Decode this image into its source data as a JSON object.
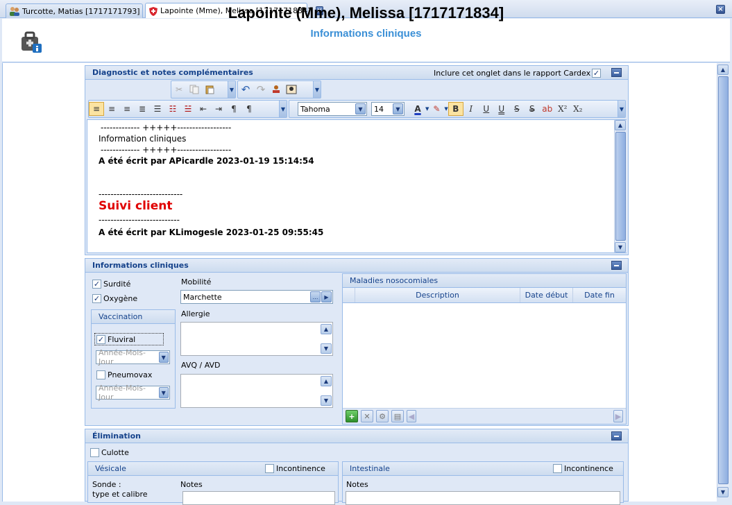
{
  "tabs": [
    {
      "label": "Turcotte, Matias [1717171793]",
      "icon": "users-icon"
    },
    {
      "label": "Lapointe (Mme), Melissa [1717171834]",
      "icon": "shield-icon"
    }
  ],
  "header": {
    "title": "Lapointe (Mme), Melissa [1717171834]",
    "subtitle": "Informations cliniques",
    "icon": "medical-bag-info-icon"
  },
  "diagnostic": {
    "title": "Diagnostic et notes complémentaires",
    "cardex_label": "Inclure cet onglet dans le rapport Cardex",
    "cardex_checked": "✓",
    "font_name": "Tahoma",
    "font_size": "14",
    "toolbar_letters": {
      "bold": "B",
      "italic": "I",
      "underline": "U",
      "underline2": "U",
      "strike": "S",
      "strike2": "S",
      "super": "X²",
      "sub": "X₂",
      "font_color": "A",
      "pilcrow": "¶"
    },
    "editor_lines": {
      "l1": "------------- +++++------------------",
      "l2": "Information cliniques",
      "l3": "------------- +++++------------------",
      "l4": "A été écrit par APicardle 2023-01-19 15:14:54",
      "l5": "----------------------------",
      "l6": "Suivi client",
      "l7": "---------------------------",
      "l8": "A été écrit par KLimogesle 2023-01-25 09:55:45"
    }
  },
  "clinical": {
    "title": "Informations cliniques",
    "surdite": "Surdité",
    "oxygene": "Oxygène",
    "check": "✓",
    "mobilite_label": "Mobilité",
    "mobilite_value": "Marchette",
    "allergie_label": "Allergie",
    "avq_label": "AVQ / AVD",
    "vaccination_title": "Vaccination",
    "fluviral": "Fluviral",
    "pneumovax": "Pneumovax",
    "date_placeholder": "Année-Mois-Jour",
    "maladies_title": "Maladies nosocomiales",
    "grid_headers": {
      "description": "Description",
      "date_debut": "Date début",
      "date_fin": "Date fin"
    },
    "ellipsis": "…"
  },
  "elimination": {
    "title": "Élimination",
    "culotte": "Culotte",
    "vesicale_title": "Vésicale",
    "intestinale_title": "Intestinale",
    "incontinence": "Incontinence",
    "sonde": "Sonde :",
    "type_calibre": "type et calibre",
    "notes": "Notes"
  },
  "colors": {
    "accent": "#3a8fd6",
    "panel_header": "#15428b",
    "suivi": "#e00000"
  }
}
